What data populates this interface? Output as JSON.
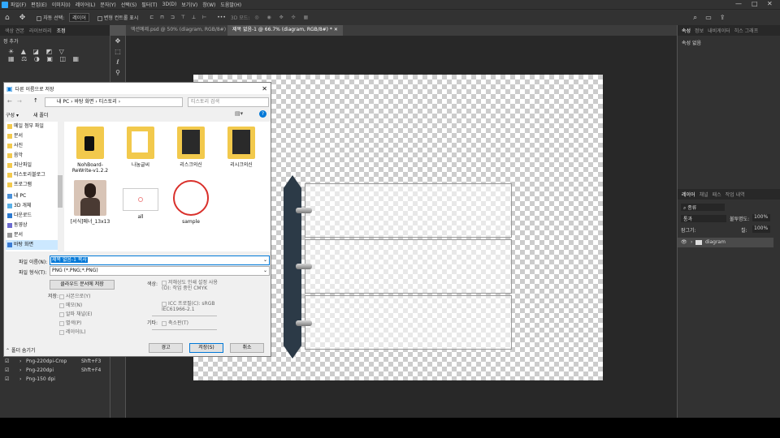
{
  "menu": {
    "items": [
      "파일(F)",
      "편집(E)",
      "이미지(I)",
      "레이어(L)",
      "문자(Y)",
      "선택(S)",
      "필터(T)",
      "3D(D)",
      "보기(V)",
      "창(W)",
      "도움말(H)"
    ]
  },
  "options": {
    "auto_select_label": "자동 선택:",
    "auto_select_value": "레이어",
    "transform_controls_label": "변형 컨트롤 표시",
    "mode_3d_label": "3D 모드:"
  },
  "tabs": [
    {
      "label": "액션예제.psd @ 50% (diagram, RGB/8#)",
      "active": false
    },
    {
      "label": "제목 없음-1 @ 66.7% (diagram, RGB/8#) *",
      "active": true
    }
  ],
  "left_panel": {
    "tabs": [
      "색상 견본",
      "라이브러리",
      "조정"
    ],
    "adjust_title": "정 추가",
    "actions": [
      {
        "label": "Png-220dpi-Crop",
        "shortcut": "Shft+F3"
      },
      {
        "label": "Png-220dpi",
        "shortcut": "Shft+F4"
      },
      {
        "label": "Png-150 dpi",
        "shortcut": ""
      }
    ]
  },
  "right_panel": {
    "top_tabs": [
      "속성",
      "정보",
      "내비게이터",
      "히스 그래프"
    ],
    "properties_empty": "속성 없음",
    "layer_tabs": [
      "레이어",
      "채널",
      "패스",
      "작업 내역"
    ],
    "filter_label": "종류",
    "blend_mode": "통과",
    "opacity_label": "불투명도:",
    "opacity_value": "100%",
    "lock_label": "잠그기:",
    "fill_label": "칠:",
    "fill_value": "100%",
    "layer_name": "diagram"
  },
  "dialog": {
    "title": "다른 이름으로 저장",
    "breadcrumb": [
      "내 PC",
      "바탕 화면",
      "티스토리"
    ],
    "search_placeholder": "티스토리 검색",
    "organize_label": "구성",
    "new_folder_label": "새 폴더",
    "nav_items": [
      "메일 첨부 파일",
      "문서",
      "사진",
      "음악",
      "지난파일",
      "티스토리블로그",
      "프로그램",
      "내 PC",
      "3D 개체",
      "다운로드",
      "동영상",
      "문서",
      "바탕 화면"
    ],
    "files": [
      {
        "name": "NohBoard-ReWrite-v1.2.2",
        "kind": "folder"
      },
      {
        "name": "나눔글씨",
        "kind": "folder"
      },
      {
        "name": "리스크의신",
        "kind": "folder"
      },
      {
        "name": "리시크의신",
        "kind": "folder"
      },
      {
        "name": "[서식]메너_13x13",
        "kind": "photo"
      },
      {
        "name": "all",
        "kind": "image"
      },
      {
        "name": "sample",
        "kind": "circle"
      }
    ],
    "filename_label": "파일 이름(N):",
    "filename_value": "제목 없음-1 복사",
    "filetype_label": "파일 형식(T):",
    "filetype_value": "PNG (*.PNG;*.PNG)",
    "cloud_button": "클라우드 문서에 저장",
    "save_label": "저장:",
    "save_options": [
      "사본으로(Y)",
      "메모(N)",
      "알파 채널(E)",
      "별색(P)",
      "레이어(L)"
    ],
    "color_label": "색상:",
    "color_options": [
      "저해상도 인쇄 설정 사용(O): 작업 중인 CMYK",
      "ICC 프로필(C): sRGB IEC61966-2.1"
    ],
    "other_label": "기타:",
    "thumbnail_label": "축소판(T)",
    "hide_folders": "폴더 숨기기",
    "buttons": {
      "cancel_left": "경고",
      "save": "저장(S)",
      "cancel": "취소"
    },
    "accent": "#0078d7"
  }
}
